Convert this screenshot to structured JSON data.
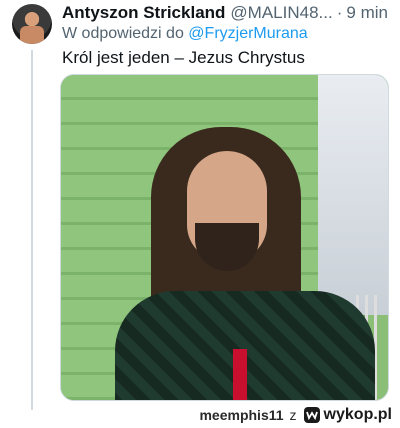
{
  "tweet": {
    "author_name": "Antyszon Strickland",
    "author_handle": "@MALIN48...",
    "dot": "·",
    "time": "9 min",
    "reply_prefix": "W odpowiedzi do",
    "reply_handle": "@FryzjerMurana",
    "text": "Król jest jeden – Jezus Chrystus"
  },
  "watermark": {
    "user": "meemphis11",
    "conj": "z",
    "site": "wykop.pl"
  },
  "colors": {
    "link": "#1d9bf0",
    "secondary_text": "#536471"
  }
}
